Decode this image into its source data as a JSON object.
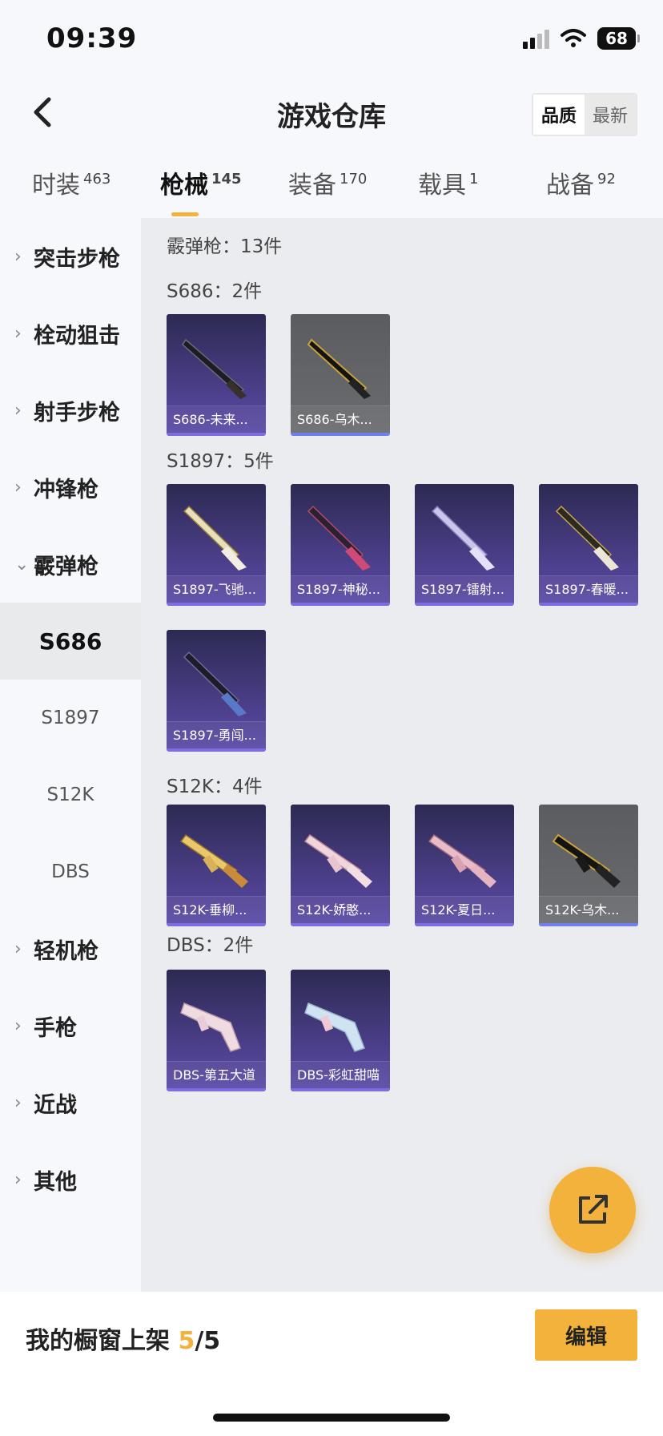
{
  "status_bar": {
    "time": "09:39",
    "battery": "68"
  },
  "header": {
    "title": "游戏仓库",
    "sort_quality": "品质",
    "sort_newest": "最新"
  },
  "tabs": [
    {
      "label": "时装",
      "count": "463"
    },
    {
      "label": "枪械",
      "count": "145"
    },
    {
      "label": "装备",
      "count": "170"
    },
    {
      "label": "载具",
      "count": "1"
    },
    {
      "label": "战备",
      "count": "92"
    }
  ],
  "sidebar": {
    "categories": [
      "突击步枪",
      "栓动狙击",
      "射手步枪",
      "冲锋枪",
      "霰弹枪",
      "轻机枪",
      "手枪",
      "近战",
      "其他"
    ],
    "subcategories": [
      "S686",
      "S1897",
      "S12K",
      "DBS"
    ]
  },
  "content": {
    "total": "霰弹枪：13件",
    "groups": [
      {
        "title": "S686：2件",
        "items": [
          "S686-未来...",
          "S686-乌木..."
        ]
      },
      {
        "title": "S1897：5件",
        "items": [
          "S1897-飞驰...",
          "S1897-神秘...",
          "S1897-镭射...",
          "S1897-春暖...",
          "S1897-勇闯..."
        ]
      },
      {
        "title": "S12K：4件",
        "items": [
          "S12K-垂柳...",
          "S12K-娇憨...",
          "S12K-夏日...",
          "S12K-乌木..."
        ]
      },
      {
        "title": "DBS：2件",
        "items": [
          "DBS-第五大道",
          "DBS-彩虹甜喵"
        ]
      }
    ]
  },
  "footer": {
    "showcase_prefix": "我的橱窗上架 ",
    "showcase_count": "5",
    "showcase_total": "/5",
    "edit_label": "编辑"
  },
  "colors": {
    "accent": "#f2b23c",
    "card_purple": "#4c3f8a",
    "card_gray": "#5b5c60"
  },
  "icons": [
    "back-arrow-icon",
    "wifi-icon",
    "signal-icon",
    "battery-icon",
    "chevron-right-icon",
    "chevron-down-icon",
    "share-icon"
  ]
}
